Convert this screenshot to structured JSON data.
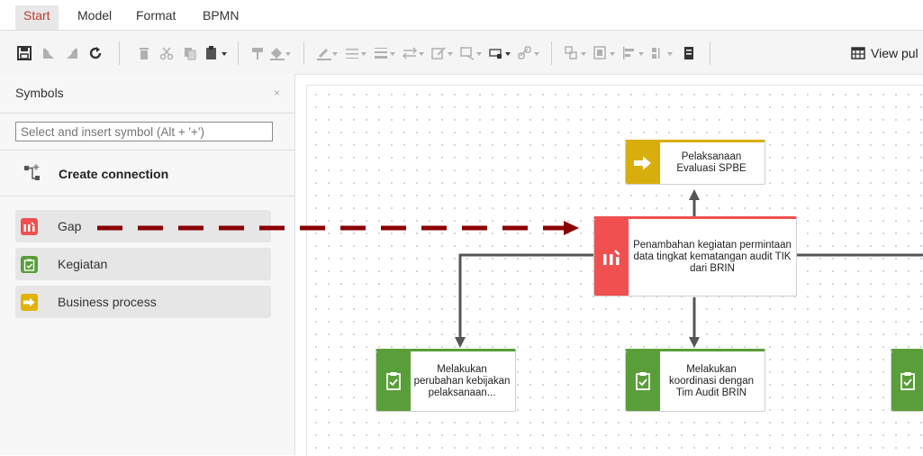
{
  "menu": {
    "tabs": [
      "Start",
      "Model",
      "Format",
      "BPMN"
    ],
    "active": "Start",
    "accent": "#c0392b"
  },
  "toolbar": {
    "view_label": "View pul"
  },
  "sidebar": {
    "title": "Symbols",
    "close_glyph": "×",
    "search_placeholder": "Select and insert symbol (Alt + '+')",
    "create_connection": "Create connection",
    "items": [
      {
        "label": "Gap",
        "icon": "gap-icon",
        "color": "#f05050"
      },
      {
        "label": "Kegiatan",
        "icon": "clipboard-check-icon",
        "color": "#5a9e3a"
      },
      {
        "label": "Business process",
        "icon": "arrow-right-icon",
        "color": "#e0b400"
      }
    ]
  },
  "canvas": {
    "nodes": {
      "evaluasi": {
        "text": "Pelaksanaan Evaluasi SPBE",
        "color": "#d8ae0c",
        "type": "Business process"
      },
      "gap": {
        "text": "Penambahan kegiatan permintaan data tingkat kematangan audit TIK dari BRIN",
        "color": "#f05050",
        "type": "Gap"
      },
      "kebijakan": {
        "text": "Melakukan perubahan kebijakan pelaksanaan...",
        "color": "#5a9e3a",
        "type": "Kegiatan"
      },
      "koordinasi": {
        "text": "Melakukan koordinasi dengan Tim Audit BRIN",
        "color": "#5a9e3a",
        "type": "Kegiatan"
      }
    },
    "drag_arrow_color": "#8b0000"
  }
}
